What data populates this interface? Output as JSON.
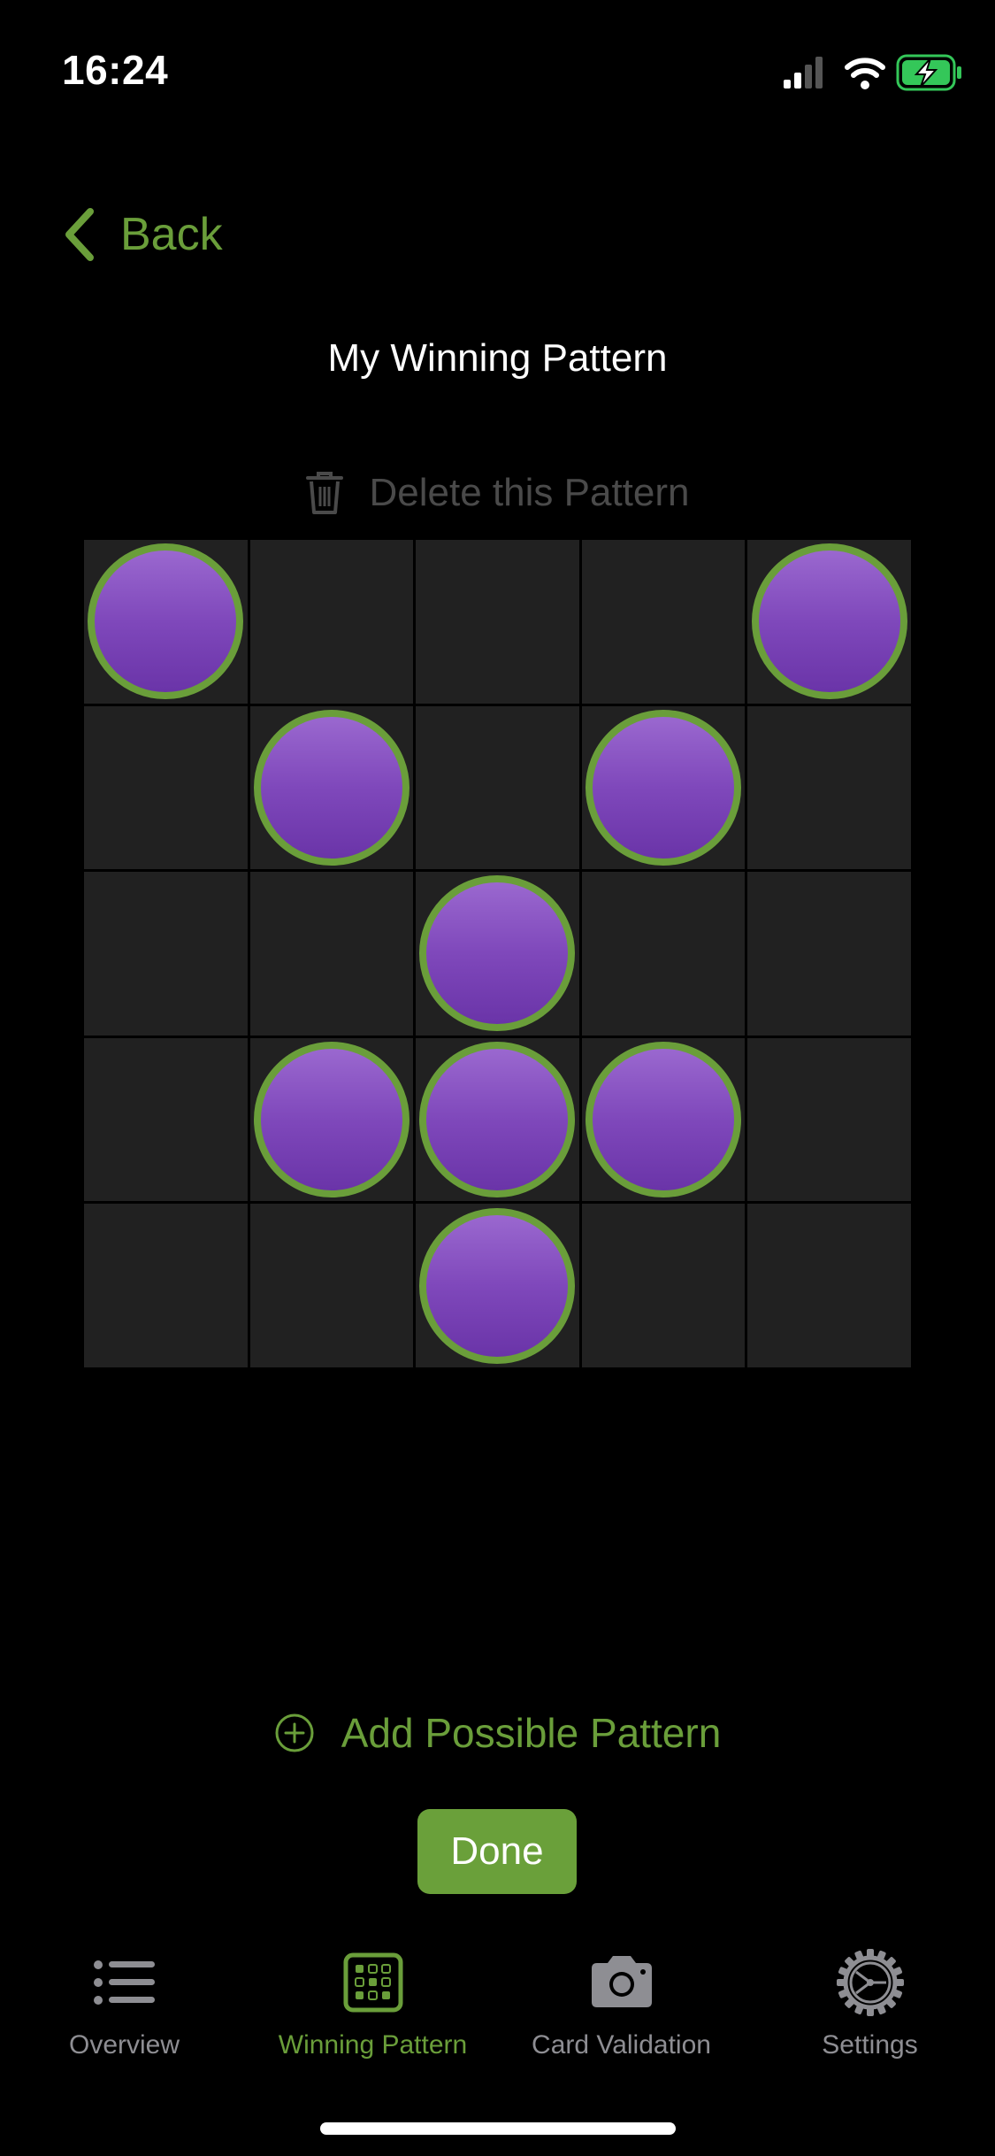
{
  "status_bar": {
    "time": "16:24",
    "icons": [
      "signal-icon",
      "wifi-icon",
      "battery-charging-icon"
    ]
  },
  "nav": {
    "back_label": "Back"
  },
  "page": {
    "title": "My Winning Pattern",
    "delete_label": "Delete this Pattern"
  },
  "pattern": {
    "rows": 5,
    "cols": 5,
    "marked": [
      [
        true,
        false,
        false,
        false,
        true
      ],
      [
        false,
        true,
        false,
        true,
        false
      ],
      [
        false,
        false,
        true,
        false,
        false
      ],
      [
        false,
        true,
        true,
        true,
        false
      ],
      [
        false,
        false,
        true,
        false,
        false
      ]
    ]
  },
  "actions": {
    "add_label": "Add Possible Pattern",
    "done_label": "Done"
  },
  "tabbar": {
    "items": [
      {
        "label": "Overview",
        "icon": "list-icon",
        "active": false
      },
      {
        "label": "Winning Pattern",
        "icon": "pattern-grid-icon",
        "active": true
      },
      {
        "label": "Card Validation",
        "icon": "camera-icon",
        "active": false
      },
      {
        "label": "Settings",
        "icon": "gear-icon",
        "active": false
      }
    ]
  },
  "colors": {
    "accent": "#6a9e3a",
    "token": "#7f48bb",
    "cell": "#212121",
    "background": "#000000",
    "inactive": "#8e8e93",
    "disabled": "#4a4a4a"
  }
}
